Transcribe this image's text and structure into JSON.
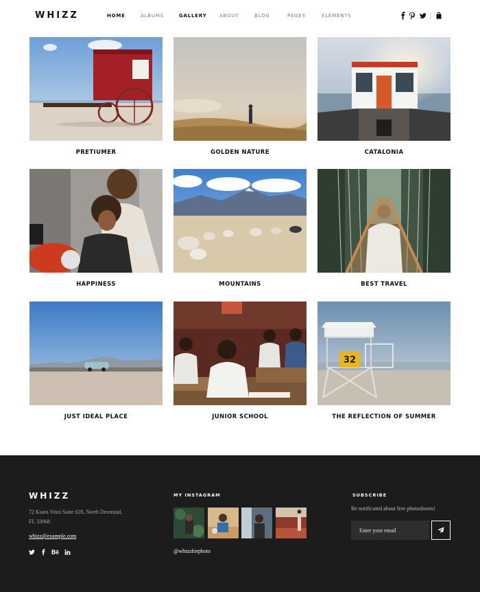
{
  "header": {
    "logo": "WHIZZ",
    "nav": [
      {
        "label": "HOME",
        "active": true
      },
      {
        "label": "ALBUMS",
        "active": false
      },
      {
        "label": "GALLERY",
        "active": true
      },
      {
        "label": "ABOUT",
        "active": false
      },
      {
        "label": "BLOG",
        "active": false
      },
      {
        "label": "PAGES",
        "active": false
      },
      {
        "label": "ELEMENTS",
        "active": false
      }
    ],
    "social_icons": [
      "facebook-icon",
      "pinterest-icon",
      "twitter-icon"
    ],
    "cart_icon": "shopping-bag-icon"
  },
  "gallery": [
    {
      "title": "PRETIUMER"
    },
    {
      "title": "GOLDEN NATURE"
    },
    {
      "title": "CATALONIA"
    },
    {
      "title": "HAPPINESS"
    },
    {
      "title": "MOUNTAINS"
    },
    {
      "title": "BEST TRAVEL"
    },
    {
      "title": "JUST IDEAL PLACE"
    },
    {
      "title": "JUNIOR SCHOOL"
    },
    {
      "title": "THE REFLECTION OF SUMMER"
    }
  ],
  "photo_text": {
    "lifeguard_number": "32"
  },
  "footer": {
    "logo": "WHIZZ",
    "address_line1": "72 Ksara Vista Suite 028, North Deonstad,",
    "address_line2": "FL 33068",
    "email": "whizz@example.com",
    "social_icons": [
      "twitter-icon",
      "facebook-icon",
      "behance-icon",
      "linkedin-icon"
    ],
    "instagram": {
      "heading": "MY INSTAGRAM",
      "handle": "@whizzforphoto"
    },
    "subscribe": {
      "heading": "SUBSCRIBE",
      "text": "Be notificated about free photoshoots!",
      "placeholder": "Enter your email",
      "button_icon": "paper-plane-icon"
    }
  },
  "colors": {
    "footer_bg": "#1c1c1c",
    "text_dark": "#111111",
    "nav_muted": "#777777"
  }
}
